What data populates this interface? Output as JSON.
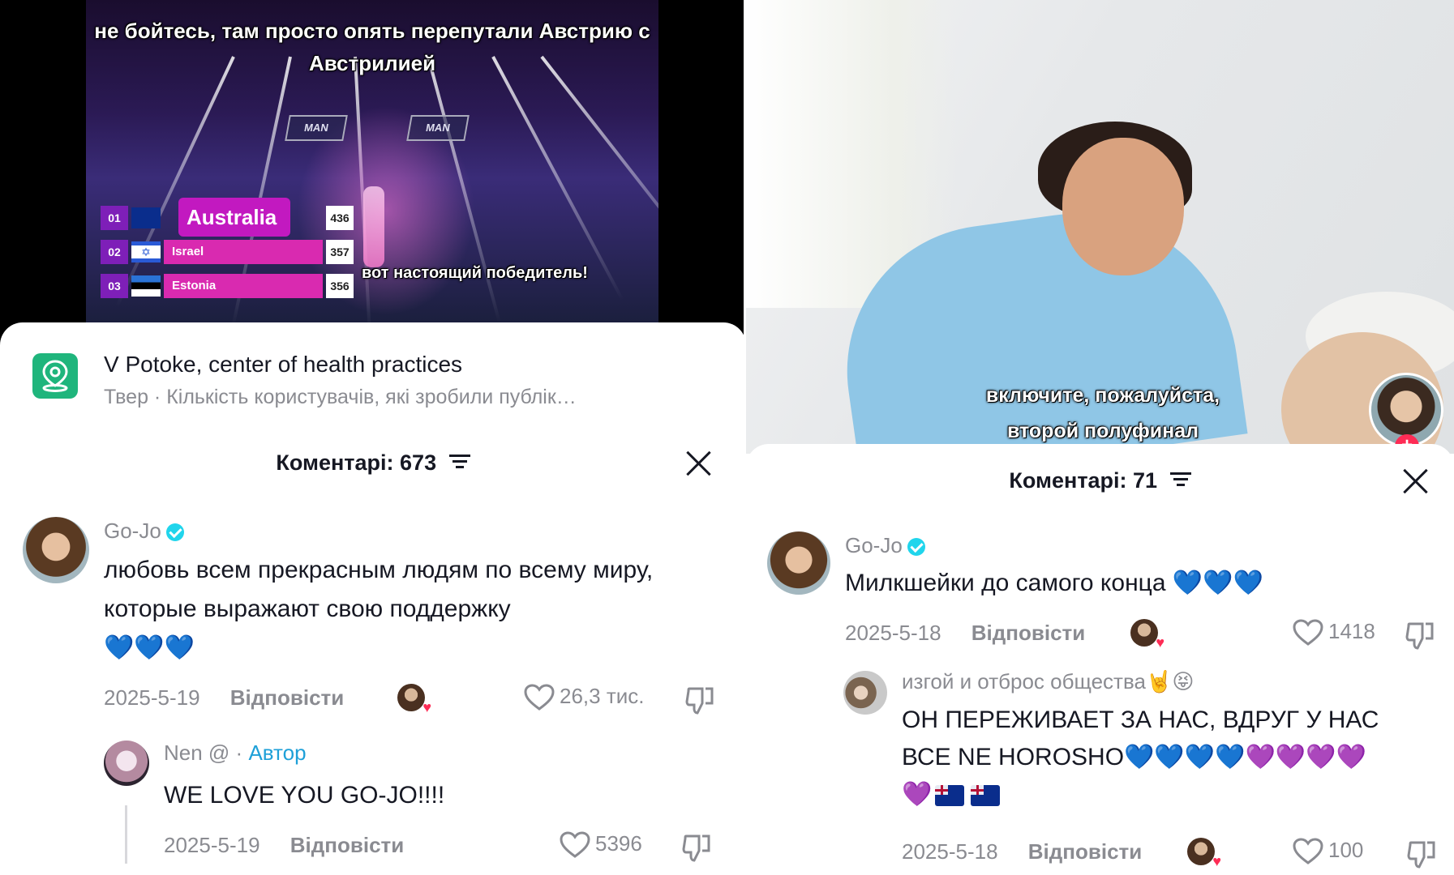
{
  "left": {
    "video": {
      "subtitle_top": "не бойтесь, там просто опять перепутали Австрию с Австрилией",
      "subtitle_bottom": "вот настоящий победитель!",
      "stage_sign": "MAN",
      "scoreboard": [
        {
          "rank": "01",
          "country": "Australia",
          "points": "436"
        },
        {
          "rank": "02",
          "country": "Israel",
          "points": "357"
        },
        {
          "rank": "03",
          "country": "Estonia",
          "points": "356"
        }
      ]
    },
    "location": {
      "title": "V Potoke, center of health practices",
      "subtitle": "Твер · Кількість користувачів, які зробили публік…"
    },
    "comments_header": "Коментарі: 673",
    "comments": [
      {
        "user": "Go-Jo",
        "text": "любовь всем прекрасным людям по всему миру, которые выражают свою поддержку",
        "hearts": "💙💙💙",
        "date": "2025-5-19",
        "reply_label": "Відповісти",
        "likes": "26,3 тис."
      },
      {
        "user": "Nen @",
        "author_label": "Автор",
        "text": "WE LOVE YOU GO-JO!!!!",
        "date": "2025-5-19",
        "reply_label": "Відповісти",
        "likes": "5396"
      }
    ]
  },
  "right": {
    "video": {
      "subtitle_line1": "включите, пожалуйста,",
      "subtitle_line2": "второй полуфинал"
    },
    "comments_header": "Коментарі: 71",
    "comments": [
      {
        "user": "Go-Jo",
        "text": "Милкшейки до самого конца",
        "date": "2025-5-18",
        "reply_label": "Відповісти",
        "likes": "1418"
      },
      {
        "user": "изгой и отброс общества🤘😝",
        "text_line1": "ОН ПЕРЕЖИВАЕТ ЗА НАС, ВДРУГ У НАС",
        "text_line2": "ВСЕ NE HOROSHO",
        "date": "2025-5-18",
        "reply_label": "Відповісти",
        "likes": "100"
      }
    ]
  },
  "colors": {
    "accent_blue": "#20d5ec",
    "author_blue": "#1ea0d8",
    "like_red": "#fe2c55",
    "scoreboard_pink": "#d92ab0",
    "location_green": "#1fb57c"
  }
}
